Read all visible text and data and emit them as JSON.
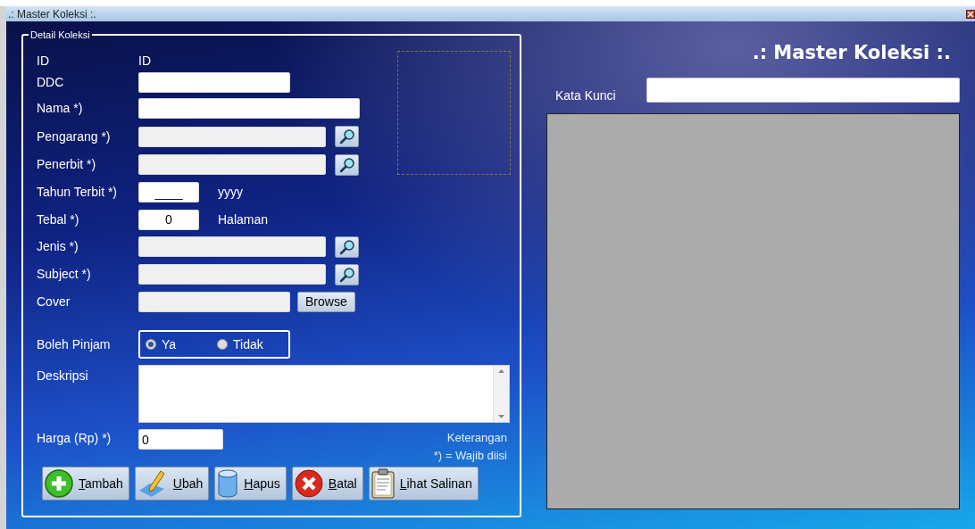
{
  "window": {
    "title": ".: Master Koleksi :."
  },
  "group": {
    "title": "Detail Koleksi"
  },
  "fields": [
    {
      "kind": "static",
      "label": "ID",
      "value": "ID"
    },
    {
      "kind": "input",
      "label": "DDC",
      "disabled": false
    },
    {
      "kind": "input",
      "label": "Nama *)",
      "disabled": false
    },
    {
      "kind": "lookup",
      "label": "Pengarang *)",
      "disabled": true
    },
    {
      "kind": "lookup",
      "label": "Penerbit *)",
      "disabled": true
    },
    {
      "kind": "input",
      "label": "Tahun Terbit *)",
      "value": "____",
      "suffix": "yyyy",
      "disabled": false
    },
    {
      "kind": "input",
      "label": "Tebal *)",
      "value": "0",
      "suffix": "Halaman",
      "disabled": false
    },
    {
      "kind": "lookup",
      "label": "Jenis *)",
      "disabled": true
    },
    {
      "kind": "lookup",
      "label": "Subject *)",
      "disabled": true
    },
    {
      "kind": "browse",
      "label": "Cover",
      "button": "Browse",
      "disabled": true
    },
    {
      "kind": "radio",
      "label": "Boleh Pinjam",
      "options": [
        {
          "label": "Ya",
          "selected": true
        },
        {
          "label": "Tidak",
          "selected": false
        }
      ]
    },
    {
      "kind": "textarea",
      "label": "Deskripsi"
    },
    {
      "kind": "input",
      "label": "Harga (Rp) *)",
      "value": "0",
      "disabled": false
    }
  ],
  "note": {
    "title": "Keterangan",
    "text": "*) =  Wajib diisi"
  },
  "buttons": [
    {
      "kind": "plus",
      "accel": "T",
      "rest": "ambah"
    },
    {
      "kind": "pencil",
      "accel": "U",
      "rest": "bah"
    },
    {
      "kind": "cylinder",
      "accel": "H",
      "rest": "apus"
    },
    {
      "kind": "cross",
      "accel": "B",
      "rest": "atal"
    },
    {
      "kind": "clipboard",
      "accel": "L",
      "rest": "ihat Salinan"
    }
  ],
  "header": {
    "title": ".: Master Koleksi :."
  },
  "search": {
    "label": "Kata Kunci"
  }
}
